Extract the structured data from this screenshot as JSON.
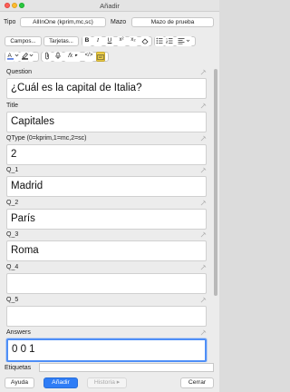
{
  "window": {
    "title": "Añadir"
  },
  "type_row": {
    "type_label": "Tipo",
    "type_value": "AllInOne (kprim,mc,sc)",
    "deck_label": "Mazo",
    "deck_value": "Mazo de prueba"
  },
  "toolbar": {
    "fields_button": "Campos...",
    "cards_button": "Tarjetas...",
    "bold_icon": "bold-icon",
    "italic_icon": "italic-icon",
    "underline_icon": "underline-icon",
    "superscript_icon": "superscript-icon",
    "subscript_icon": "subscript-icon",
    "eraser_icon": "eraser-icon",
    "bullet_list_icon": "bullet-list-icon",
    "numbered_list_icon": "numbered-list-icon",
    "align_icon": "align-icon",
    "text_color_icon": "text-color-icon",
    "highlight_icon": "highlight-icon",
    "attach_icon": "paperclip-icon",
    "record_icon": "microphone-icon",
    "formula_icon": "function-icon",
    "html_icon": "code-icon",
    "image_occlusion_icon": "image-occlusion-icon",
    "text_color": "#1f4fd8",
    "highlight_color": "#111111",
    "accent": "#f5d64b"
  },
  "fields": [
    {
      "label": "Question",
      "value": "¿Cuál es la capital de Italia?"
    },
    {
      "label": "Title",
      "value": "Capitales"
    },
    {
      "label": "QType (0=kprim,1=mc,2=sc)",
      "value": "2"
    },
    {
      "label": "Q_1",
      "value": "Madrid"
    },
    {
      "label": "Q_2",
      "value": "París"
    },
    {
      "label": "Q_3",
      "value": "Roma"
    },
    {
      "label": "Q_4",
      "value": ""
    },
    {
      "label": "Q_5",
      "value": ""
    },
    {
      "label": "Answers",
      "value": "0 0 1"
    }
  ],
  "tags": {
    "label": "Etiquetas",
    "value": ""
  },
  "buttons": {
    "help": "Ayuda",
    "add": "Añadir",
    "history": "Historia ▸",
    "close": "Cerrar"
  }
}
